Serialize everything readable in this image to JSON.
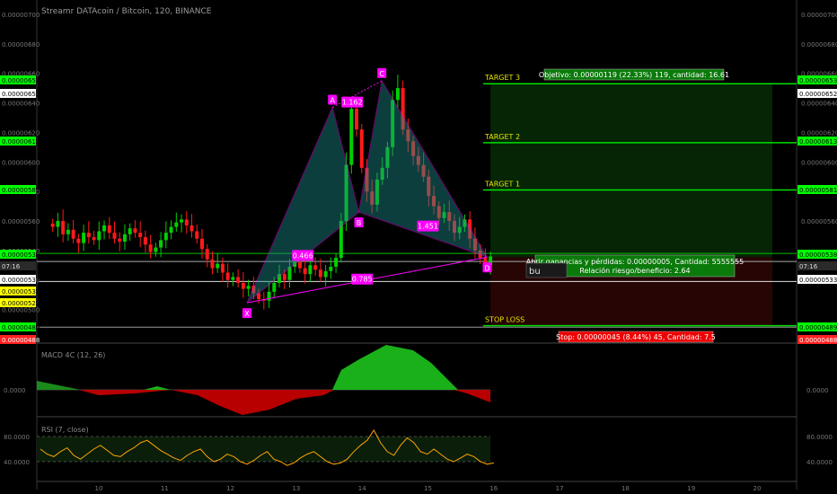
{
  "header": {
    "title": "Streamr DATAcoin / Bitcoin, 120, BINANCE"
  },
  "price_axis": {
    "ticks": [
      "0.00000700",
      "0.00000680",
      "0.00000660",
      "0.00000640",
      "0.00000620",
      "0.00000600",
      "0.00000580",
      "0.00000560",
      "0.00000540",
      "0.00000520",
      "0.00000500"
    ],
    "right_ticks": [
      "0.00000700",
      "0.00000680",
      "0.00000660",
      "0.00000640",
      "0.00000620",
      "0.00000600",
      "0.00000580",
      "0.00000560"
    ],
    "tags": [
      {
        "text": "0.00000653",
        "color": "#00ff00"
      },
      {
        "text": "0.00000652",
        "color": "#ffffff"
      },
      {
        "text": "0.00000613",
        "color": "#00ff00"
      },
      {
        "text": "0.00000581",
        "color": "#00ff00"
      },
      {
        "text": "0.00000538",
        "color": "#00ff00"
      },
      {
        "text": "07:16",
        "color": "#2a2a2a"
      },
      {
        "text": "0.00000533",
        "color": "#ffffff"
      },
      {
        "text": "0.00000533",
        "color": "#ffff00"
      },
      {
        "text": "0.00000522",
        "color": "#ffff00"
      },
      {
        "text": "0.00000489",
        "color": "#00ff00"
      },
      {
        "text": "0.00000488",
        "color": "#ff2020"
      }
    ],
    "right_tags": [
      {
        "text": "0.00000653",
        "color": "#00ff00"
      },
      {
        "text": "0.00000652",
        "color": "#ffffff"
      },
      {
        "text": "0.00000613",
        "color": "#00ff00"
      },
      {
        "text": "0.00000581",
        "color": "#00ff00"
      },
      {
        "text": "0.00000538",
        "color": "#00ff00"
      },
      {
        "text": "07:16",
        "color": "#2a2a2a"
      },
      {
        "text": "0.00000533",
        "color": "#ffffff"
      },
      {
        "text": "0.00000489",
        "color": "#00ff00"
      },
      {
        "text": "0.00000488",
        "color": "#ff2020"
      }
    ]
  },
  "pattern": {
    "points": [
      {
        "label": "X",
        "price": 5.045e-06,
        "t": 12.25
      },
      {
        "label": "A",
        "price": 6.37e-06,
        "t": 13.55
      },
      {
        "label": "B",
        "price": 5.66e-06,
        "t": 13.95
      },
      {
        "label": "C",
        "price": 6.55e-06,
        "t": 14.3
      },
      {
        "label": "D",
        "price": 5.355e-06,
        "t": 15.9
      }
    ],
    "ratios": [
      {
        "text": "1.162",
        "price": 6.4e-06,
        "t": 13.85
      },
      {
        "text": "0.466",
        "price": 5.36e-06,
        "t": 13.1
      },
      {
        "text": "1.451",
        "price": 5.56e-06,
        "t": 15.0
      },
      {
        "text": "0.785",
        "price": 5.2e-06,
        "t": 14.0
      }
    ]
  },
  "targets": [
    {
      "label": "TARGET 3",
      "price": 6.53e-06
    },
    {
      "label": "TARGET 2",
      "price": 6.13e-06
    },
    {
      "label": "TARGET 1",
      "price": 5.81e-06
    },
    {
      "label": "STOP LOSS",
      "price": 4.89e-06
    }
  ],
  "info_boxes": {
    "objective": "Objetivo: 0.00000119 (22.33%) 119, cantidad: 16.61",
    "open_pnl": "Abrir ganancias y pérdidas: 0.00000005, Cantidad: 5555555",
    "risk_reward": "Relación riesgo/beneficio: 2.64",
    "stop": "Stop: 0.00000045 (8.44%) 45, Cantidad: 7.5",
    "buy_label": "bu"
  },
  "macd": {
    "title": "MACD 4C (12, 26)",
    "tick": "0.0000"
  },
  "rsi": {
    "title": "RSI (7, close)",
    "ticks": [
      "80.0000",
      "40.0000"
    ]
  },
  "time_axis": {
    "labels": [
      "10",
      "11",
      "12",
      "13",
      "14",
      "15",
      "16",
      "17",
      "18",
      "19",
      "20"
    ]
  },
  "colors": {
    "up": "#00d000",
    "down": "#ff1a1a",
    "target": "#00e000",
    "pattern": "#ff00ff",
    "stop": "#ff2020"
  },
  "chart_data": {
    "type": "candlestick",
    "series_close": [
      5.56e-06,
      5.6e-06,
      5.51e-06,
      5.54e-06,
      5.48e-06,
      5.45e-06,
      5.52e-06,
      5.49e-06,
      5.47e-06,
      5.53e-06,
      5.57e-06,
      5.52e-06,
      5.48e-06,
      5.46e-06,
      5.51e-06,
      5.55e-06,
      5.52e-06,
      5.49e-06,
      5.44e-06,
      5.39e-06,
      5.42e-06,
      5.47e-06,
      5.52e-06,
      5.56e-06,
      5.59e-06,
      5.61e-06,
      5.57e-06,
      5.53e-06,
      5.48e-06,
      5.41e-06,
      5.34e-06,
      5.28e-06,
      5.31e-06,
      5.25e-06,
      5.2e-06,
      5.22e-06,
      5.18e-06,
      5.14e-06,
      5.16e-06,
      5.11e-06,
      5.07e-06,
      5.06e-06,
      5.12e-06,
      5.18e-06,
      5.24e-06,
      5.2e-06,
      5.29e-06,
      5.32e-06,
      5.28e-06,
      5.24e-06,
      5.3e-06,
      5.27e-06,
      5.22e-06,
      5.26e-06,
      5.29e-06,
      5.35e-06,
      5.6e-06,
      5.98e-06,
      6.36e-06,
      6.22e-06,
      5.96e-06,
      5.8e-06,
      5.71e-06,
      5.88e-06,
      5.96e-06,
      6.1e-06,
      6.42e-06,
      6.5e-06,
      6.22e-06,
      6.14e-06,
      6.04e-06,
      5.98e-06,
      5.9e-06,
      5.77e-06,
      5.7e-06,
      5.62e-06,
      5.66e-06,
      5.6e-06,
      5.52e-06,
      5.56e-06,
      5.61e-06,
      5.48e-06,
      5.4e-06,
      5.35e-06,
      5.3e-06,
      5.36e-06
    ]
  }
}
